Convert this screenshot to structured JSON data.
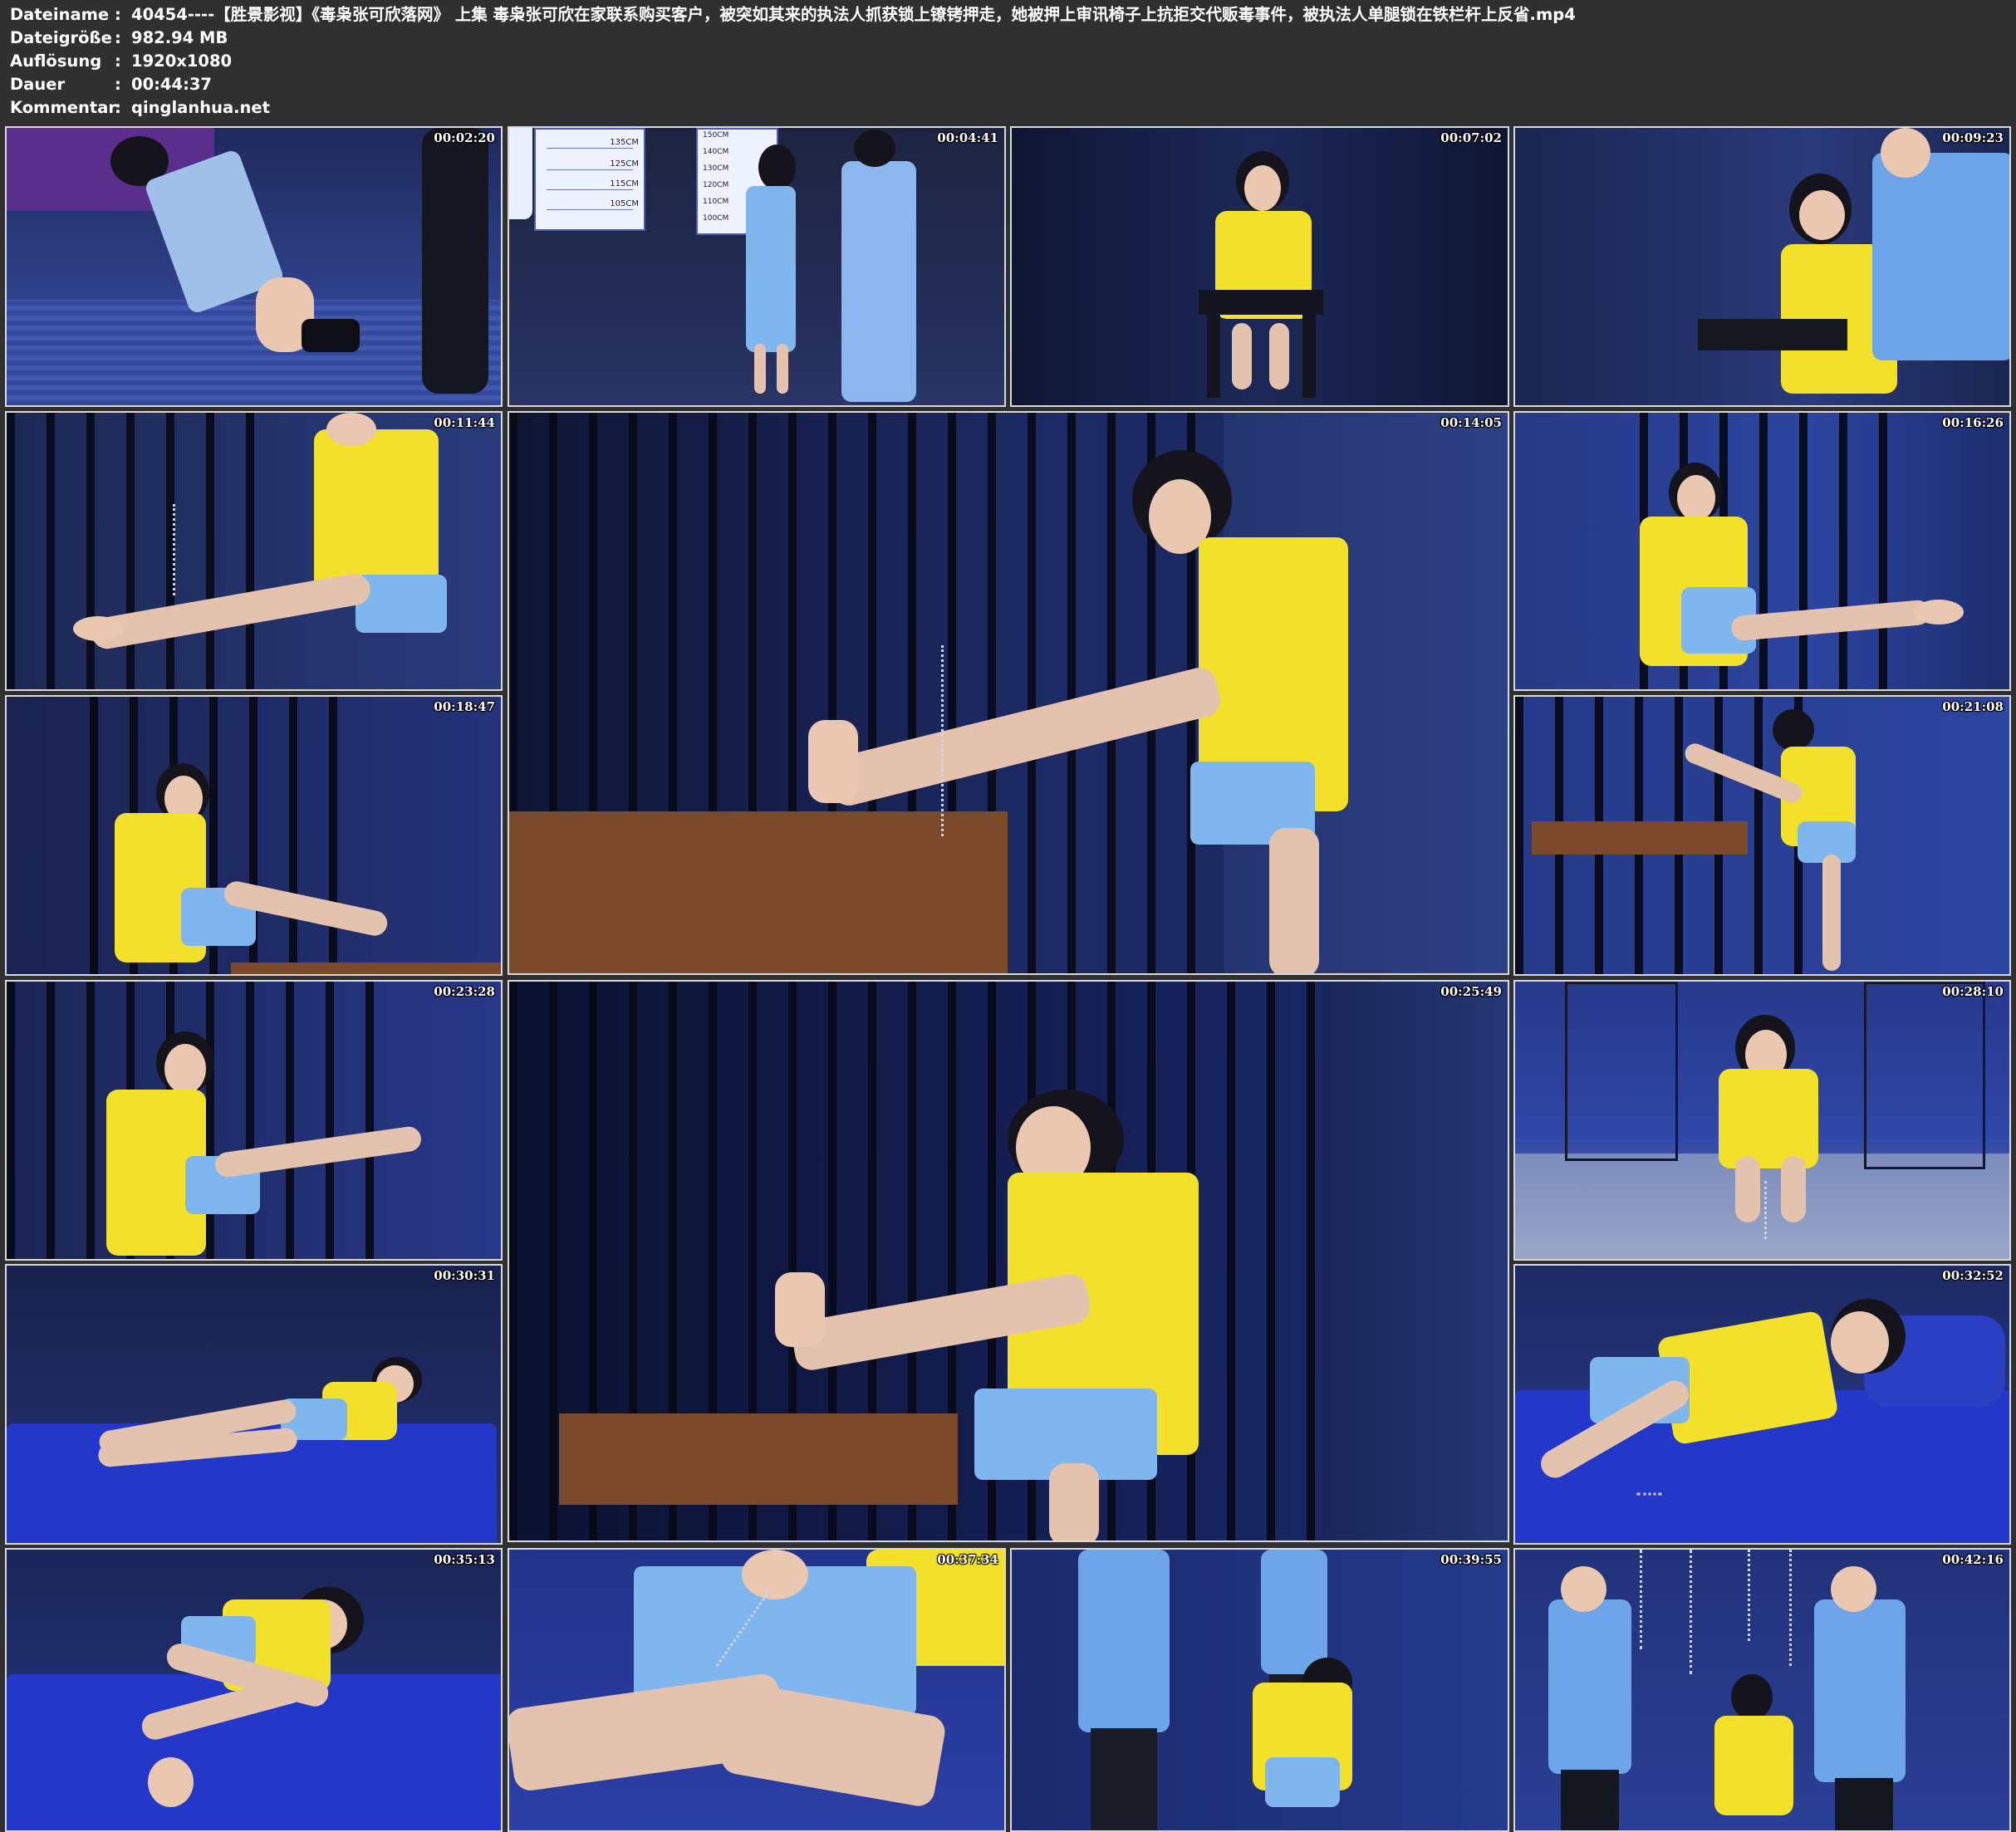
{
  "metadata": {
    "rows": [
      {
        "key": "Dateiname",
        "sep": ":",
        "value": "40454----【胜景影视】《毒枭张可欣落网》 上集 毒枭张可欣在家联系购买客户，被突如其来的执法人抓获锁上镣铐押走，她被押上审讯椅子上抗拒交代贩毒事件，被执法人单腿锁在铁栏杆上反省.mp4"
      },
      {
        "key": "Dateigröße",
        "sep": ":",
        "value": "982.94 MB"
      },
      {
        "key": "Auflösung",
        "sep": ":",
        "value": "1920x1080"
      },
      {
        "key": "Dauer",
        "sep": ":",
        "value": "00:44:37"
      },
      {
        "key": "Kommentar",
        "sep": ":",
        "value": "qinglanhua.net"
      }
    ]
  },
  "thumbnails": [
    {
      "timestamp": "00:02:20"
    },
    {
      "timestamp": "00:04:41"
    },
    {
      "timestamp": "00:07:02"
    },
    {
      "timestamp": "00:09:23"
    },
    {
      "timestamp": "00:11:44"
    },
    {
      "timestamp": "00:14:05"
    },
    {
      "timestamp": "00:16:26"
    },
    {
      "timestamp": "00:18:47"
    },
    {
      "timestamp": "00:21:08"
    },
    {
      "timestamp": "00:23:28"
    },
    {
      "timestamp": "00:25:49"
    },
    {
      "timestamp": "00:28:10"
    },
    {
      "timestamp": "00:30:31"
    },
    {
      "timestamp": "00:32:52"
    },
    {
      "timestamp": "00:35:13"
    },
    {
      "timestamp": "00:37:34"
    },
    {
      "timestamp": "00:39:55"
    },
    {
      "timestamp": "00:42:16"
    }
  ],
  "height_chart": {
    "labels_left": [
      "135CM",
      "125CM",
      "115CM",
      "105CM"
    ],
    "labels_right": [
      "150CM",
      "140CM",
      "130CM",
      "120CM",
      "110CM",
      "100CM"
    ]
  },
  "colors": {
    "background": "#303030",
    "vest_yellow": "#f2e02a",
    "skirt_blue": "#7fb6ee",
    "uniform_blue": "#6ea4e8",
    "bed_blue": "#2338c9"
  }
}
